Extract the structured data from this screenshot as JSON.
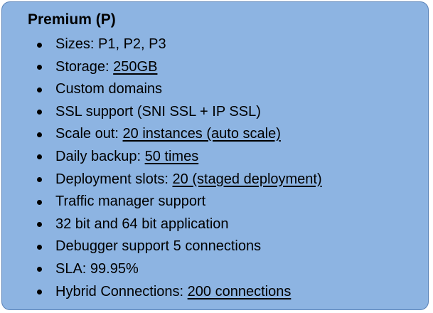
{
  "card": {
    "title": "Premium (P)",
    "items": [
      {
        "text": "Sizes: P1, P2, P3",
        "link": ""
      },
      {
        "text": "Storage: ",
        "link": "250GB"
      },
      {
        "text": "Custom domains",
        "link": ""
      },
      {
        "text": "SSL support (SNI SSL + IP SSL)",
        "link": ""
      },
      {
        "text": "Scale out: ",
        "link": "20 instances (auto scale)"
      },
      {
        "text": "Daily backup: ",
        "link": "50 times"
      },
      {
        "text": "Deployment slots: ",
        "link": "20 (staged deployment)"
      },
      {
        "text": "Traffic manager support",
        "link": ""
      },
      {
        "text": "32 bit and 64 bit application",
        "link": ""
      },
      {
        "text": "Debugger support 5 connections",
        "link": ""
      },
      {
        "text": "SLA: 99.95%",
        "link": ""
      },
      {
        "text": "Hybrid Connections: ",
        "link": "200 connections"
      }
    ]
  },
  "colors": {
    "card_background": "#8db4e2",
    "card_border": "#5b83b8",
    "text": "#000000"
  }
}
